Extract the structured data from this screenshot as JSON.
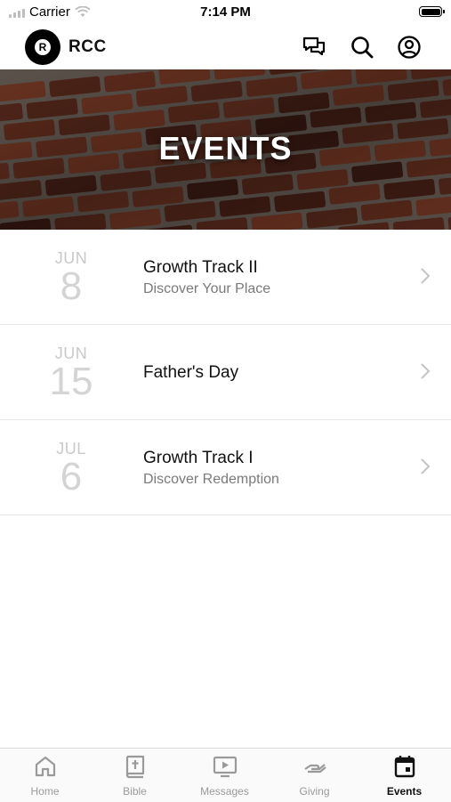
{
  "status_bar": {
    "carrier": "Carrier",
    "time": "7:14 PM"
  },
  "header": {
    "logo_letter": "R",
    "brand": "RCC"
  },
  "hero": {
    "title": "EVENTS"
  },
  "events": [
    {
      "month": "JUN",
      "day": "8",
      "title": "Growth Track II",
      "subtitle": "Discover Your Place"
    },
    {
      "month": "JUN",
      "day": "15",
      "title": "Father's Day",
      "subtitle": ""
    },
    {
      "month": "JUL",
      "day": "6",
      "title": "Growth Track I",
      "subtitle": "Discover Redemption"
    }
  ],
  "tabs": [
    {
      "label": "Home",
      "icon": "home-icon"
    },
    {
      "label": "Bible",
      "icon": "bible-icon"
    },
    {
      "label": "Messages",
      "icon": "messages-icon"
    },
    {
      "label": "Giving",
      "icon": "giving-icon"
    },
    {
      "label": "Events",
      "icon": "calendar-icon",
      "active": true
    }
  ],
  "colors": {
    "active_tab": "#111111",
    "inactive_tab": "#9a9a9a",
    "date_text": "#c9c9c9"
  }
}
